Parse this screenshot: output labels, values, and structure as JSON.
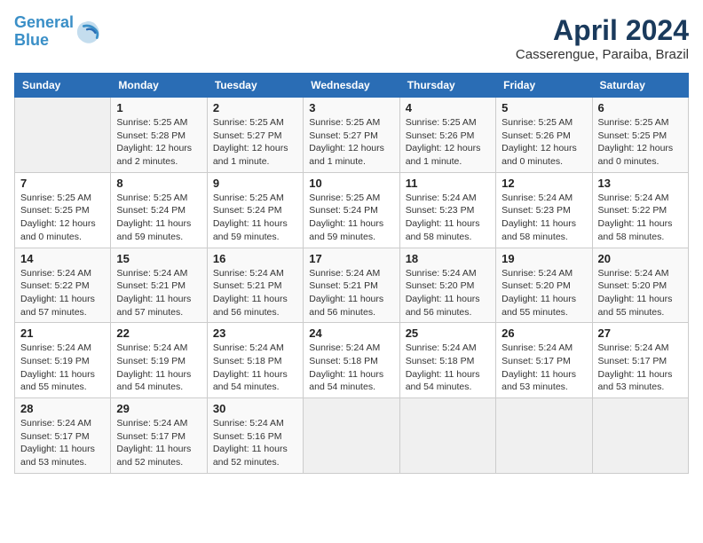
{
  "header": {
    "logo_line1": "General",
    "logo_line2": "Blue",
    "month_title": "April 2024",
    "location": "Casserengue, Paraiba, Brazil"
  },
  "days_of_week": [
    "Sunday",
    "Monday",
    "Tuesday",
    "Wednesday",
    "Thursday",
    "Friday",
    "Saturday"
  ],
  "weeks": [
    [
      {
        "day": "",
        "info": ""
      },
      {
        "day": "1",
        "info": "Sunrise: 5:25 AM\nSunset: 5:28 PM\nDaylight: 12 hours\nand 2 minutes."
      },
      {
        "day": "2",
        "info": "Sunrise: 5:25 AM\nSunset: 5:27 PM\nDaylight: 12 hours\nand 1 minute."
      },
      {
        "day": "3",
        "info": "Sunrise: 5:25 AM\nSunset: 5:27 PM\nDaylight: 12 hours\nand 1 minute."
      },
      {
        "day": "4",
        "info": "Sunrise: 5:25 AM\nSunset: 5:26 PM\nDaylight: 12 hours\nand 1 minute."
      },
      {
        "day": "5",
        "info": "Sunrise: 5:25 AM\nSunset: 5:26 PM\nDaylight: 12 hours\nand 0 minutes."
      },
      {
        "day": "6",
        "info": "Sunrise: 5:25 AM\nSunset: 5:25 PM\nDaylight: 12 hours\nand 0 minutes."
      }
    ],
    [
      {
        "day": "7",
        "info": "Sunrise: 5:25 AM\nSunset: 5:25 PM\nDaylight: 12 hours\nand 0 minutes."
      },
      {
        "day": "8",
        "info": "Sunrise: 5:25 AM\nSunset: 5:24 PM\nDaylight: 11 hours\nand 59 minutes."
      },
      {
        "day": "9",
        "info": "Sunrise: 5:25 AM\nSunset: 5:24 PM\nDaylight: 11 hours\nand 59 minutes."
      },
      {
        "day": "10",
        "info": "Sunrise: 5:25 AM\nSunset: 5:24 PM\nDaylight: 11 hours\nand 59 minutes."
      },
      {
        "day": "11",
        "info": "Sunrise: 5:24 AM\nSunset: 5:23 PM\nDaylight: 11 hours\nand 58 minutes."
      },
      {
        "day": "12",
        "info": "Sunrise: 5:24 AM\nSunset: 5:23 PM\nDaylight: 11 hours\nand 58 minutes."
      },
      {
        "day": "13",
        "info": "Sunrise: 5:24 AM\nSunset: 5:22 PM\nDaylight: 11 hours\nand 58 minutes."
      }
    ],
    [
      {
        "day": "14",
        "info": "Sunrise: 5:24 AM\nSunset: 5:22 PM\nDaylight: 11 hours\nand 57 minutes."
      },
      {
        "day": "15",
        "info": "Sunrise: 5:24 AM\nSunset: 5:21 PM\nDaylight: 11 hours\nand 57 minutes."
      },
      {
        "day": "16",
        "info": "Sunrise: 5:24 AM\nSunset: 5:21 PM\nDaylight: 11 hours\nand 56 minutes."
      },
      {
        "day": "17",
        "info": "Sunrise: 5:24 AM\nSunset: 5:21 PM\nDaylight: 11 hours\nand 56 minutes."
      },
      {
        "day": "18",
        "info": "Sunrise: 5:24 AM\nSunset: 5:20 PM\nDaylight: 11 hours\nand 56 minutes."
      },
      {
        "day": "19",
        "info": "Sunrise: 5:24 AM\nSunset: 5:20 PM\nDaylight: 11 hours\nand 55 minutes."
      },
      {
        "day": "20",
        "info": "Sunrise: 5:24 AM\nSunset: 5:20 PM\nDaylight: 11 hours\nand 55 minutes."
      }
    ],
    [
      {
        "day": "21",
        "info": "Sunrise: 5:24 AM\nSunset: 5:19 PM\nDaylight: 11 hours\nand 55 minutes."
      },
      {
        "day": "22",
        "info": "Sunrise: 5:24 AM\nSunset: 5:19 PM\nDaylight: 11 hours\nand 54 minutes."
      },
      {
        "day": "23",
        "info": "Sunrise: 5:24 AM\nSunset: 5:18 PM\nDaylight: 11 hours\nand 54 minutes."
      },
      {
        "day": "24",
        "info": "Sunrise: 5:24 AM\nSunset: 5:18 PM\nDaylight: 11 hours\nand 54 minutes."
      },
      {
        "day": "25",
        "info": "Sunrise: 5:24 AM\nSunset: 5:18 PM\nDaylight: 11 hours\nand 54 minutes."
      },
      {
        "day": "26",
        "info": "Sunrise: 5:24 AM\nSunset: 5:17 PM\nDaylight: 11 hours\nand 53 minutes."
      },
      {
        "day": "27",
        "info": "Sunrise: 5:24 AM\nSunset: 5:17 PM\nDaylight: 11 hours\nand 53 minutes."
      }
    ],
    [
      {
        "day": "28",
        "info": "Sunrise: 5:24 AM\nSunset: 5:17 PM\nDaylight: 11 hours\nand 53 minutes."
      },
      {
        "day": "29",
        "info": "Sunrise: 5:24 AM\nSunset: 5:17 PM\nDaylight: 11 hours\nand 52 minutes."
      },
      {
        "day": "30",
        "info": "Sunrise: 5:24 AM\nSunset: 5:16 PM\nDaylight: 11 hours\nand 52 minutes."
      },
      {
        "day": "",
        "info": ""
      },
      {
        "day": "",
        "info": ""
      },
      {
        "day": "",
        "info": ""
      },
      {
        "day": "",
        "info": ""
      }
    ]
  ]
}
